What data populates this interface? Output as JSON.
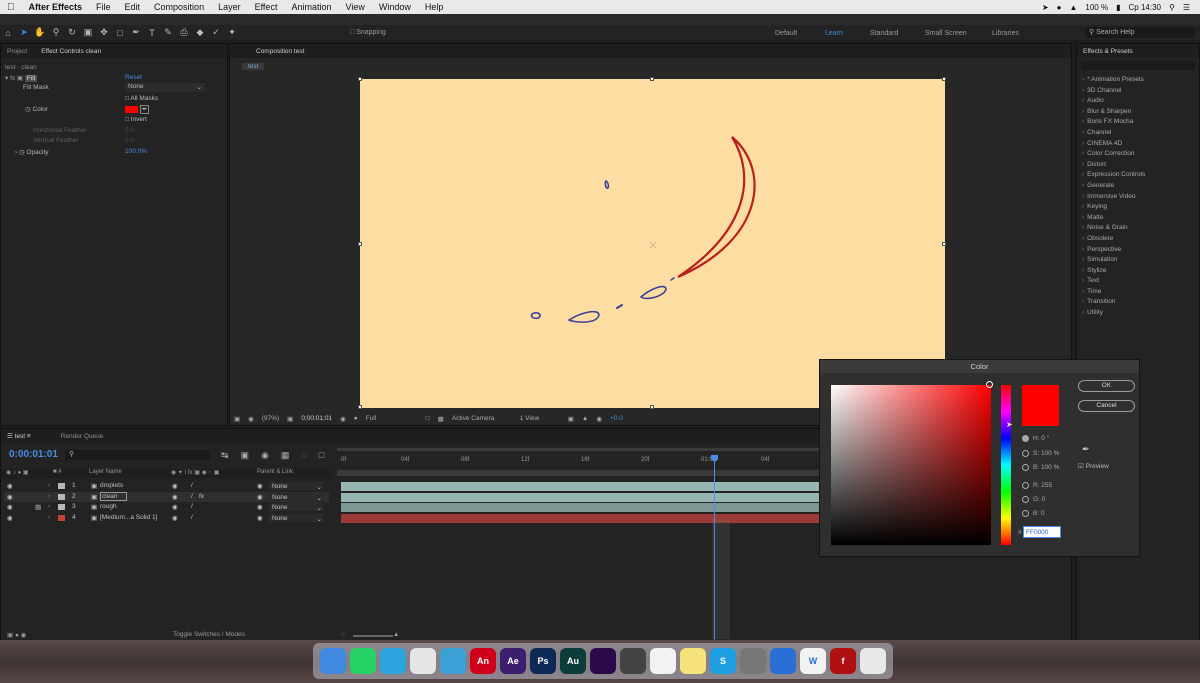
{
  "menubar": {
    "app": "After Effects",
    "items": [
      "File",
      "Edit",
      "Composition",
      "Layer",
      "Effect",
      "Animation",
      "View",
      "Window",
      "Help"
    ],
    "battery": "100 %",
    "clock": "Cp 14:30"
  },
  "toolbar": {
    "snapping": "Snapping",
    "workspaces": [
      "Default",
      "Learn",
      "Standard",
      "Small Screen",
      "Libraries"
    ],
    "active_workspace": "Learn",
    "search": "Search Help"
  },
  "left_panel": {
    "tab_project": "Project",
    "tab_effect": "Effect Controls clean",
    "layer_ref": "test · clean",
    "effect_name": "Fill",
    "reset": "Reset",
    "fill_mask_label": "Fill Mask",
    "fill_mask_value": "None",
    "all_masks": "All Masks",
    "color_label": "Color",
    "invert": "Invert",
    "h_feather": "Horizontal Feather",
    "h_feather_val": "0.0",
    "v_feather": "Vertical Feather",
    "v_feather_val": "0.0",
    "opacity_label": "Opacity",
    "opacity_value": "100.0%"
  },
  "composition": {
    "tab": "Composition test",
    "breadcrumb": "test",
    "bg_color": "#fedda2",
    "zoom": "(97%)",
    "timecode": "0;00;01;01",
    "resolution": "Full",
    "camera": "Active Camera",
    "view": "1 View",
    "exposure": "+0.0"
  },
  "effects_presets": {
    "title": "Effects & Presets",
    "items": [
      "* Animation Presets",
      "3D Channel",
      "Audio",
      "Blur & Sharpen",
      "Boris FX Mocha",
      "Channel",
      "CINEMA 4D",
      "Color Correction",
      "Distort",
      "Expression Controls",
      "Generate",
      "Immersive Video",
      "Keying",
      "Matte",
      "Noise & Grain",
      "Obsolete",
      "Perspective",
      "Simulation",
      "Stylize",
      "Text",
      "Time",
      "Transition",
      "Utility"
    ]
  },
  "timeline": {
    "tab": "test",
    "render_queue": "Render Queue",
    "timecode": "0:00:01:01",
    "col_layer": "Layer Name",
    "col_parent": "Parent & Link",
    "ruler": [
      "0f",
      "04f",
      "08f",
      "12f",
      "16f",
      "20f",
      "01:00f",
      "04f"
    ],
    "footer": "Toggle Switches / Modes",
    "layers": [
      {
        "num": "1",
        "name": "droplets",
        "parent": "None",
        "color": "#b7b7b7"
      },
      {
        "num": "2",
        "name": "clean",
        "parent": "None",
        "color": "#b7b7b7"
      },
      {
        "num": "3",
        "name": "rough",
        "parent": "None",
        "color": "#b7b7b7"
      },
      {
        "num": "4",
        "name": "[Medium...a Solid 1]",
        "parent": "None",
        "color": "#c7403a"
      }
    ]
  },
  "color_dialog": {
    "title": "Color",
    "ok": "OK",
    "cancel": "Cancel",
    "h": "H: 0 °",
    "s": "S: 100 %",
    "b": "B: 100 %",
    "r": "R: 255",
    "g": "G: 0",
    "bl": "B: 0",
    "hex": "FF0000",
    "preview": "Preview",
    "current_color": "#ff0000"
  },
  "dock": {
    "icons": [
      "finder-icon",
      "whatsapp-icon",
      "telegram-icon",
      "chrome-icon",
      "ps-dock-icon",
      "animate-icon",
      "after-effects-icon",
      "photoshop-icon",
      "audition-icon",
      "premiere-icon",
      "davinci-icon",
      "calendar-icon",
      "notes-icon",
      "skype-icon",
      "system-prefs-icon",
      "browser-icon",
      "w-icon",
      "flash-icon",
      "trash-icon"
    ],
    "labels": [
      "",
      "",
      "",
      "",
      "",
      "An",
      "Ae",
      "Ps",
      "Au",
      "",
      "",
      "",
      "",
      "S",
      "",
      "",
      "W",
      "f",
      ""
    ]
  }
}
